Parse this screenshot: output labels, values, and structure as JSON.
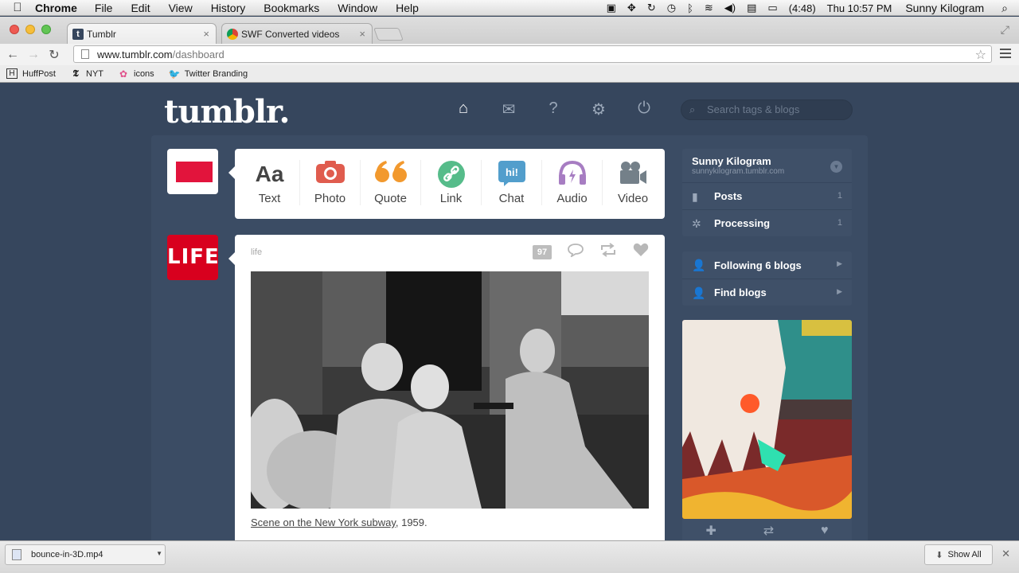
{
  "menubar": {
    "app": "Chrome",
    "items": [
      "File",
      "Edit",
      "View",
      "History",
      "Bookmarks",
      "Window",
      "Help"
    ],
    "battery": "(4:48)",
    "clock": "Thu 10:57 PM",
    "user": "Sunny Kilogram"
  },
  "tabs": [
    {
      "title": "Tumblr",
      "favicon": "tumblr-icon",
      "active": true
    },
    {
      "title": "SWF Converted videos",
      "favicon": "chrome-webstore-icon",
      "active": false
    }
  ],
  "omnibox": {
    "domain": "www.tumblr.com",
    "path": "/dashboard"
  },
  "bookmarks": [
    {
      "label": "HuffPost",
      "icon": "huffpost-icon"
    },
    {
      "label": "NYT",
      "icon": "nyt-icon"
    },
    {
      "label": "icons",
      "icon": "flower-icon"
    },
    {
      "label": "Twitter Branding",
      "icon": "twitter-icon"
    }
  ],
  "tumblr": {
    "logo": "tumblr.",
    "search_placeholder": "Search tags & blogs",
    "post_types": [
      {
        "label": "Text",
        "glyph": "Aa",
        "color": "#444444"
      },
      {
        "label": "Photo",
        "glyph": "◉",
        "color": "#e05c4e"
      },
      {
        "label": "Quote",
        "glyph": "❝",
        "color": "#f2992e"
      },
      {
        "label": "Link",
        "glyph": "∞",
        "color": "#56bc8a"
      },
      {
        "label": "Chat",
        "glyph": "hi!",
        "color": "#529ecc"
      },
      {
        "label": "Audio",
        "glyph": "♫",
        "color": "#a77dc2"
      },
      {
        "label": "Video",
        "glyph": "▶",
        "color": "#748089"
      }
    ],
    "post": {
      "avatar_text": "LIFE",
      "blog": "life",
      "notes": "97",
      "caption_link": "Scene on the New York subway",
      "caption_rest": ", 1959."
    },
    "sidebar": {
      "blog_name": "Sunny Kilogram",
      "blog_url": "sunnykilogram.tumblr.com",
      "posts_label": "Posts",
      "posts_count": "1",
      "processing_label": "Processing",
      "processing_count": "1",
      "following_label": "Following 6 blogs",
      "find_label": "Find blogs"
    }
  },
  "downloads": {
    "file": "bounce-in-3D.mp4",
    "show_all": "Show All"
  },
  "colors": {
    "tumblr_bg": "#36465d",
    "life_red": "#d8001e",
    "accent_red": "#e2143c"
  }
}
